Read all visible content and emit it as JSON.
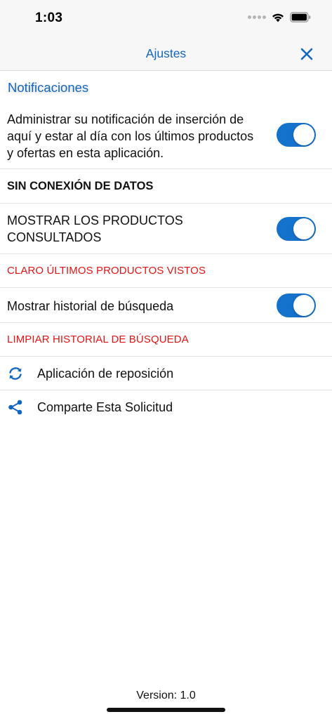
{
  "status_bar": {
    "time": "1:03"
  },
  "nav": {
    "title": "Ajustes"
  },
  "notifications": {
    "header": "Notificaciones",
    "line1": "Administrar su notificación de inserción de",
    "line2": "aquí y estar al día con los últimos productos",
    "line3": "y ofertas en esta aplicación.",
    "enabled": true
  },
  "offline": {
    "header": "SIN CONEXIÓN DE DATOS"
  },
  "show_products": {
    "line1": "MOSTRAR LOS PRODUCTOS",
    "line2": "CONSULTADOS",
    "enabled": true
  },
  "clear_products": {
    "label": "CLARO ÚLTIMOS PRODUCTOS VISTOS"
  },
  "search_history": {
    "label": "Mostrar historial de búsqueda",
    "enabled": true
  },
  "clear_history": {
    "label": "LIMPIAR HISTORIAL DE BÚSQUEDA"
  },
  "reset_app": {
    "label": "Aplicación de reposición",
    "icon": "refresh-icon"
  },
  "share_app": {
    "label": "Comparte Esta Solicitud",
    "icon": "share-icon"
  },
  "footer": {
    "version": "Version: 1.0"
  },
  "colors": {
    "accent": "#1366c0",
    "toggle_on": "#1472cc",
    "destructive": "#e01414"
  }
}
